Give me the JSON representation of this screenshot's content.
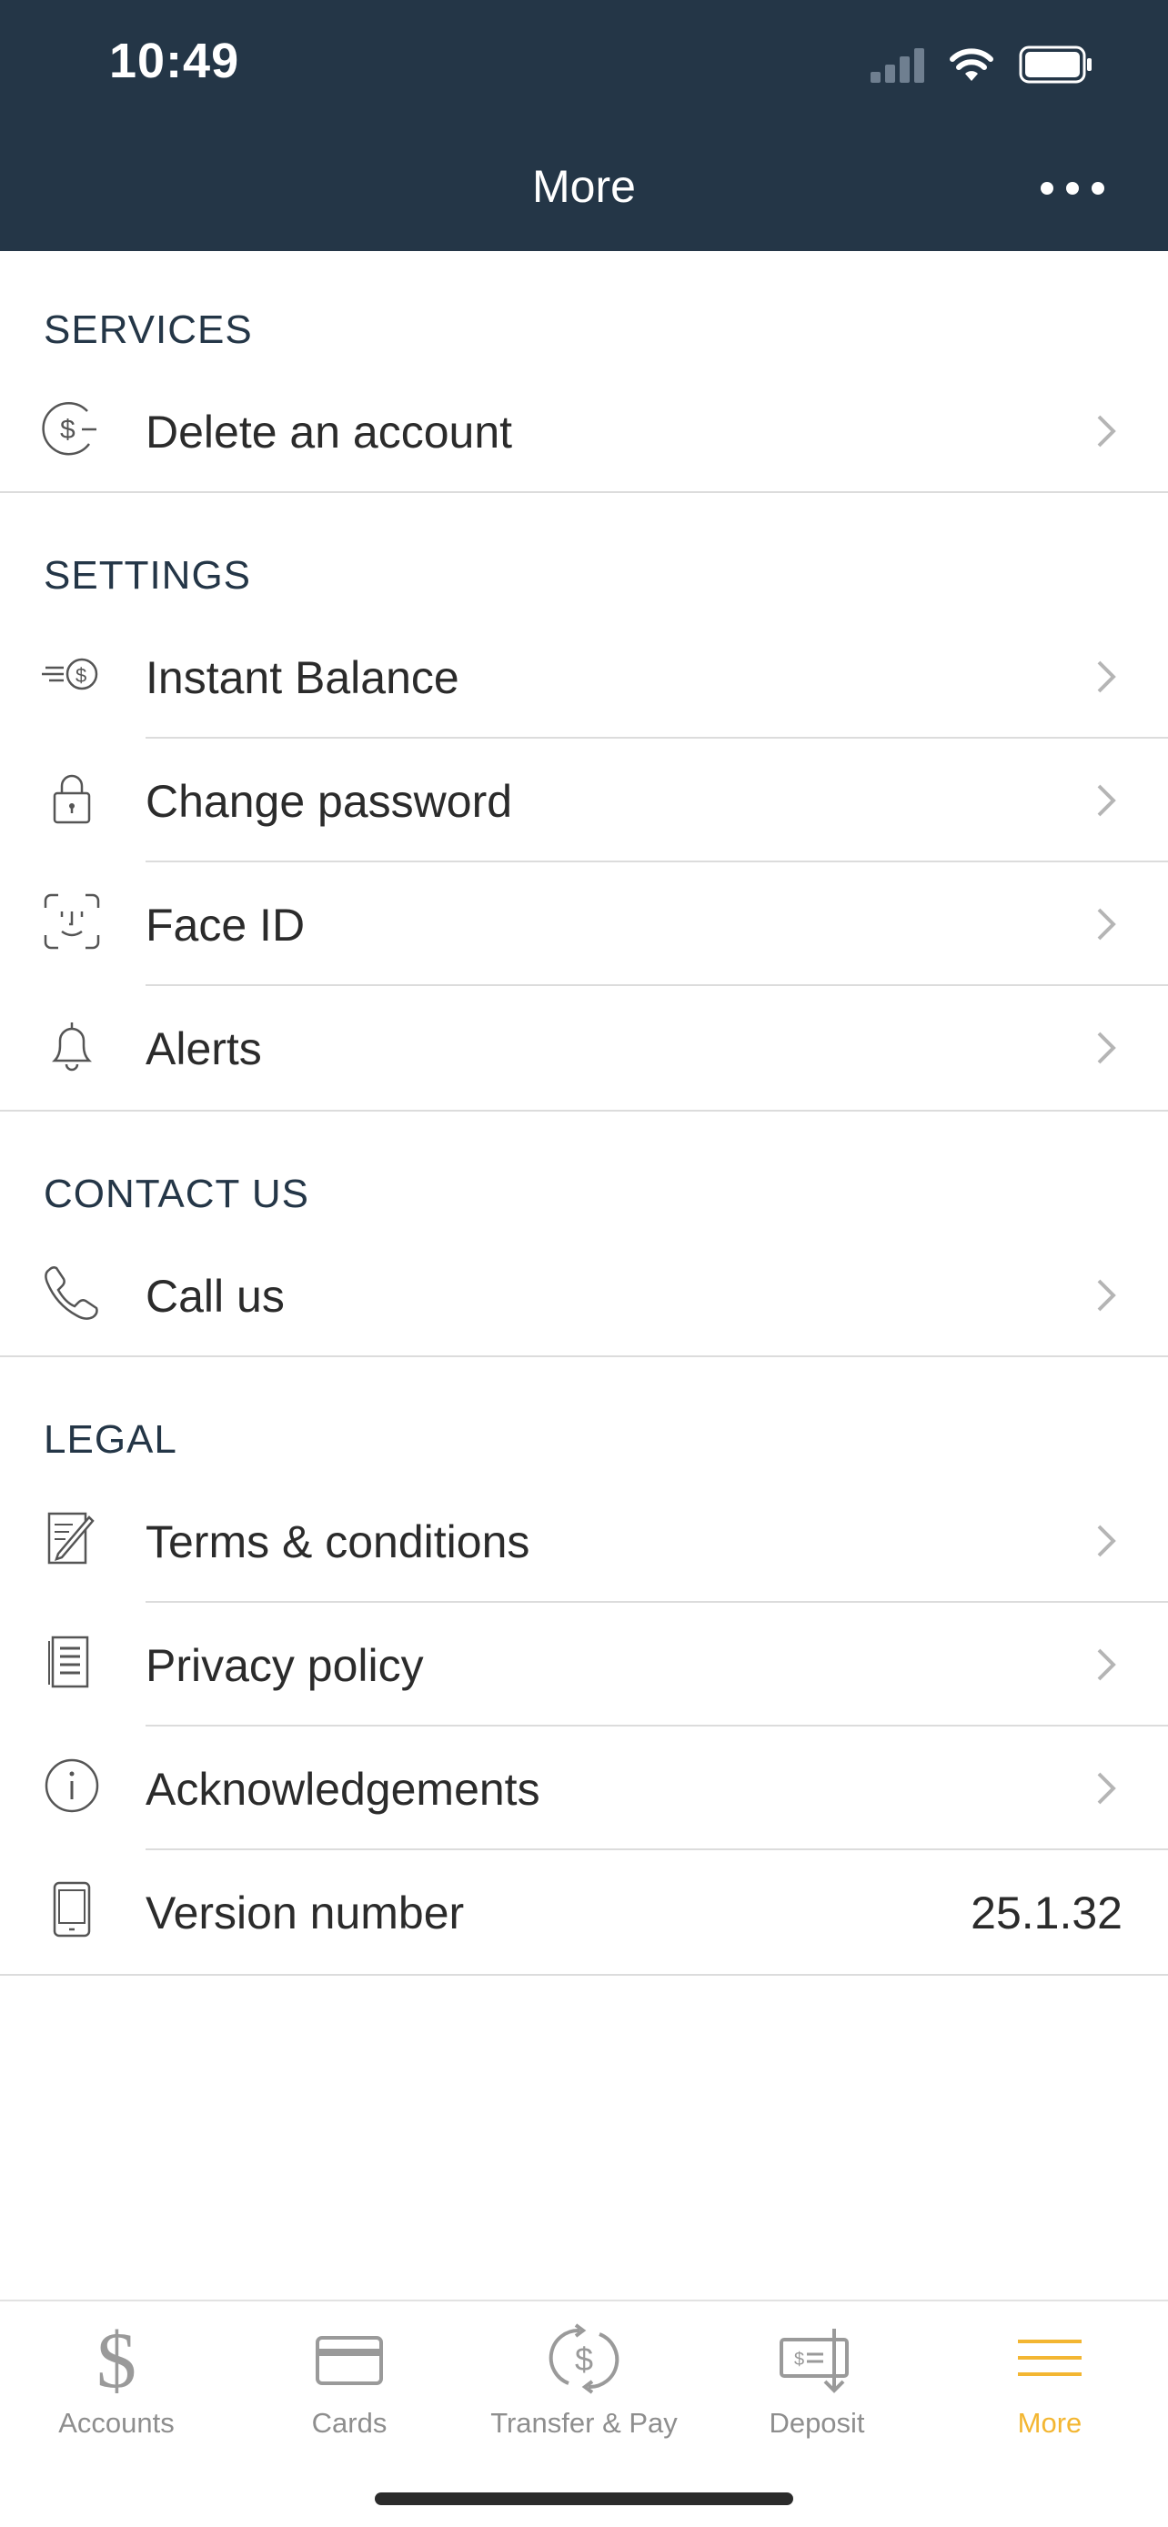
{
  "status": {
    "time": "10:49"
  },
  "header": {
    "title": "More"
  },
  "sections": [
    {
      "title": "SERVICES",
      "items": [
        {
          "label": "Delete an account",
          "icon": "dollar-circle-icon"
        }
      ]
    },
    {
      "title": "SETTINGS",
      "items": [
        {
          "label": "Instant Balance",
          "icon": "instant-balance-icon"
        },
        {
          "label": "Change password",
          "icon": "lock-icon"
        },
        {
          "label": "Face ID",
          "icon": "face-id-icon"
        },
        {
          "label": "Alerts",
          "icon": "bell-icon"
        }
      ]
    },
    {
      "title": "CONTACT US",
      "items": [
        {
          "label": "Call us",
          "icon": "phone-icon"
        }
      ]
    },
    {
      "title": "LEGAL",
      "items": [
        {
          "label": "Terms & conditions",
          "icon": "document-pen-icon"
        },
        {
          "label": "Privacy policy",
          "icon": "document-icon"
        },
        {
          "label": "Acknowledgements",
          "icon": "info-icon"
        },
        {
          "label": "Version number",
          "icon": "phone-device-icon",
          "value": "25.1.32"
        }
      ]
    }
  ],
  "tabbar": {
    "items": [
      {
        "label": "Accounts",
        "icon": "dollar-icon",
        "active": false
      },
      {
        "label": "Cards",
        "icon": "card-icon",
        "active": false
      },
      {
        "label": "Transfer & Pay",
        "icon": "transfer-icon",
        "active": false
      },
      {
        "label": "Deposit",
        "icon": "check-deposit-icon",
        "active": false
      },
      {
        "label": "More",
        "icon": "menu-icon",
        "active": true
      }
    ],
    "active_color": "#f3b632",
    "inactive_color": "#8e8e8e"
  },
  "colors": {
    "header_bg": "#243647",
    "section_title": "#243647"
  }
}
